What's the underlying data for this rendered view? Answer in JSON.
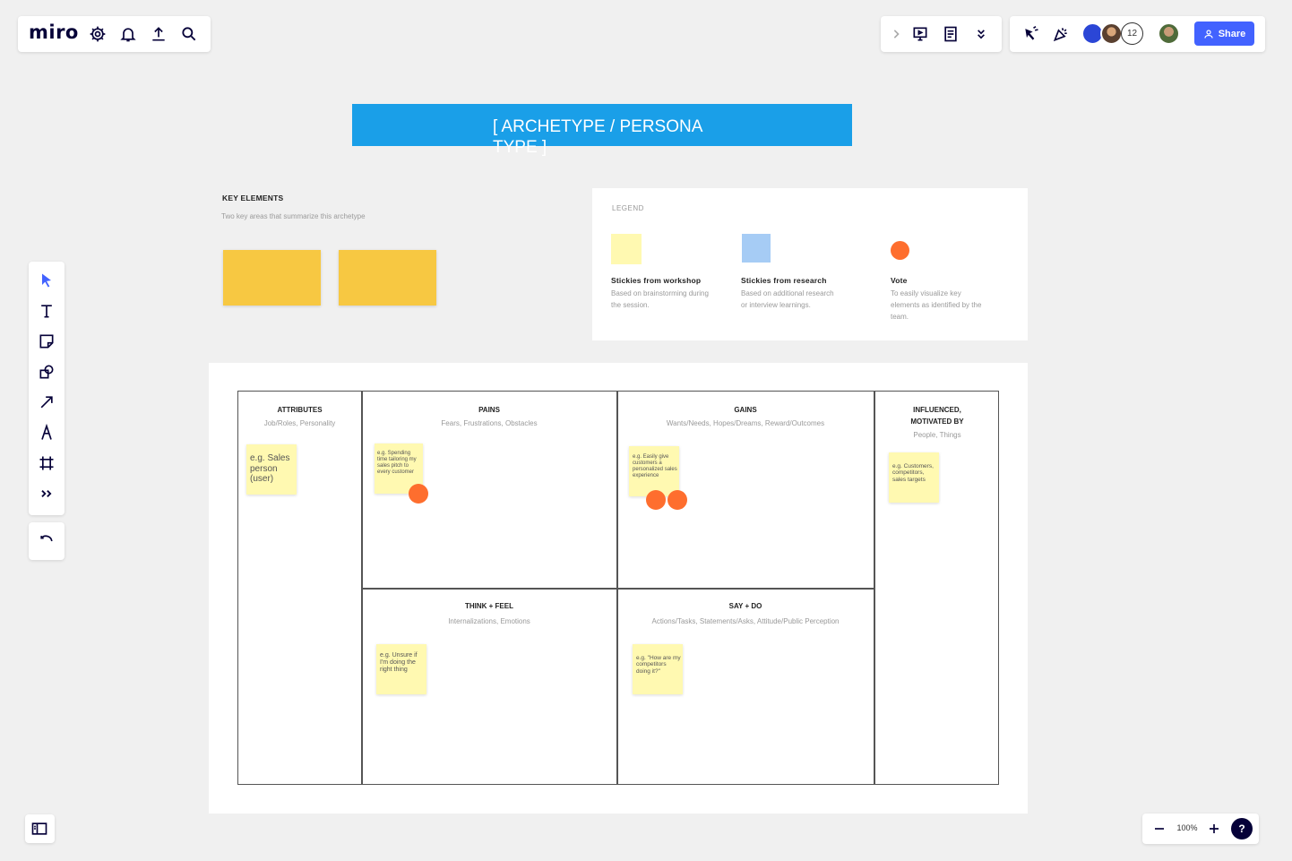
{
  "app": {
    "logo": "miro"
  },
  "topbar": {
    "left_icons": [
      "settings-icon",
      "notifications-icon",
      "upload-icon",
      "search-icon"
    ],
    "right_icons": [
      "chevron-right-icon",
      "present-icon",
      "notes-icon",
      "double-chevron-down-icon"
    ],
    "collab_icons": [
      "reaction-icon",
      "celebrate-icon"
    ],
    "collaborator_count": "12",
    "share_label": "Share",
    "accent": "#4262ff"
  },
  "toolbar": {
    "tools": [
      "select-tool-icon",
      "text-tool-icon",
      "sticky-note-tool-icon",
      "shapes-tool-icon",
      "arrow-tool-icon",
      "pen-tool-icon",
      "frame-tool-icon",
      "more-tools-icon"
    ],
    "undo": "undo-icon"
  },
  "board": {
    "title": "[ ARCHETYPE / PERSONA TYPE ]",
    "title_color": "#1a9fe8",
    "key_elements": {
      "title": "KEY ELEMENTS",
      "subtitle": "Two key areas that summarize this archetype"
    },
    "legend": {
      "title": "LEGEND",
      "items": [
        {
          "title": "Stickies from workshop",
          "desc": "Based on brainstorming during the session.",
          "color": "#fff9b1"
        },
        {
          "title": "Stickies from research",
          "desc": "Based on additional research or interview learnings.",
          "color": "#a6ccf5"
        },
        {
          "title": "Vote",
          "desc": "To easily visualize key elements as identified by the team.",
          "color": "#fe6e2e"
        }
      ]
    },
    "canvas": {
      "attributes": {
        "title": "ATTRIBUTES",
        "subtitle": "Job/Roles, Personality",
        "sticky": "e.g. Sales person (user)"
      },
      "pains": {
        "title": "PAINS",
        "subtitle": "Fears, Frustrations, Obstacles",
        "sticky": "e.g. Spending time tailoring my sales pitch to every customer"
      },
      "gains": {
        "title": "GAINS",
        "subtitle": "Wants/Needs, Hopes/Dreams, Reward/Outcomes",
        "sticky": "e.g. Easily give customers a personalized sales experience"
      },
      "influenced": {
        "title": "INFLUENCED, MOTIVATED BY",
        "subtitle": "People, Things",
        "sticky": "e.g. Customers, competitors, sales targets"
      },
      "think_feel": {
        "title": "THINK + FEEL",
        "subtitle": "Internalizations, Emotions",
        "sticky": "e.g. Unsure if I'm doing the right thing"
      },
      "say_do": {
        "title": "SAY + DO",
        "subtitle": "Actions/Tasks, Statements/Asks, Attitude/Public Perception",
        "sticky": "e.g. \"How are my competitors doing it?\""
      }
    }
  },
  "bottom": {
    "zoom": "100%",
    "help": "?"
  }
}
